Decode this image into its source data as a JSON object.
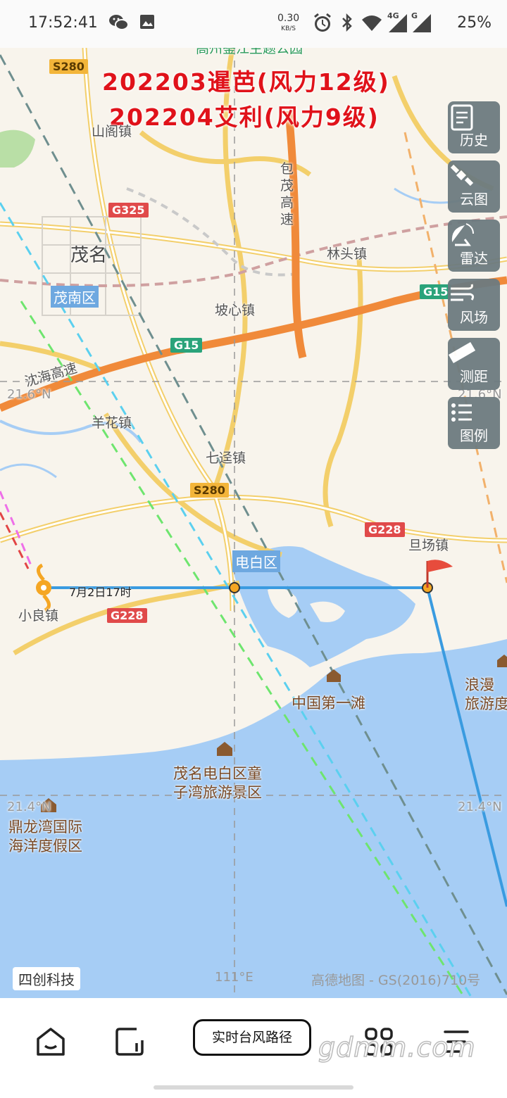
{
  "status_bar": {
    "time": "17:52:41",
    "net_speed_value": "0.30",
    "net_speed_unit": "KB/S",
    "network_4g": "4G",
    "network_g": "G",
    "battery": "25%",
    "icons": [
      "wechat-icon",
      "gallery-icon",
      "alarm-icon",
      "bluetooth-icon",
      "wifi-icon",
      "signal-icon",
      "signal-icon"
    ]
  },
  "map": {
    "title_line1": "202203暹芭(风力12级)",
    "title_line2": "202204艾利(风力9级)",
    "title_color": "#e0121a",
    "labels": {
      "shange": "山阁镇",
      "maoming": "茂名",
      "maonan": "茂南区",
      "lintou": "林头镇",
      "poxin": "坡心镇",
      "yangjiang_hwy": "沈海高速",
      "baomao_hwy": "包茂高速",
      "ganghua": "羊花镇",
      "qijing": "七迳镇",
      "dianbai": "电白区",
      "danchang": "旦场镇",
      "xiaoliang": "小良镇",
      "first_beach": "中国第一滩",
      "tongziwan": "茂名电白区童\n子湾旅游景区",
      "dinglongwan": "鼎龙湾国际\n海洋度假区",
      "langman": "浪漫\n旅游度",
      "top_cut": "高州鉴江主题公园",
      "lat_216_left": "21.6°N",
      "lat_216_right": "21.6°N",
      "lat_214_left": "21.4°N",
      "lat_214_right": "21.4°N",
      "lng_111": "111°E"
    },
    "road_badges": {
      "s280_top": "S280",
      "g325": "G325",
      "g15_mid": "G15",
      "g15_right": "G15",
      "s280_mid": "S280",
      "g228_mid": "G228",
      "g228_left": "G228"
    },
    "track_time_label": "7月2日17时",
    "brand": "四创科技",
    "copyright": "高德地图 - GS(2016)710号",
    "colors": {
      "sea": "#a6cdf5",
      "land": "#f8f4ec",
      "track": "#3a9be0",
      "highway": "#f08a3a"
    }
  },
  "side_buttons": [
    {
      "label": "历史",
      "icon": "history-icon"
    },
    {
      "label": "云图",
      "icon": "satellite-icon"
    },
    {
      "label": "雷达",
      "icon": "radar-icon"
    },
    {
      "label": "风场",
      "icon": "wind-icon"
    },
    {
      "label": "测距",
      "icon": "ruler-icon"
    },
    {
      "label": "图例",
      "icon": "legend-icon"
    }
  ],
  "bottom_nav": {
    "home_icon": "home-icon",
    "window_icon": "window-icon",
    "main_button": "实时台风路径",
    "apps_icon": "apps-icon",
    "menu_icon": "menu-icon",
    "watermark": "gdmm.com"
  }
}
